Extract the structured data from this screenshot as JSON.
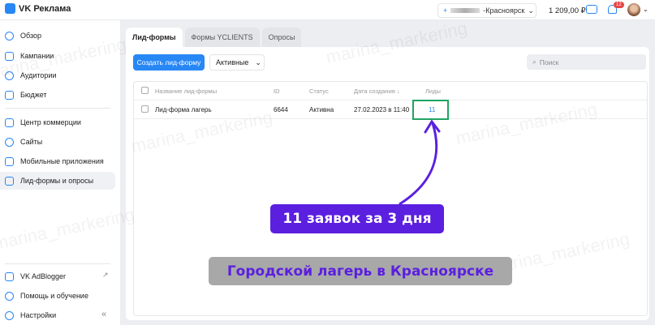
{
  "app": {
    "title": "VK Реклама"
  },
  "topbar": {
    "account": "-Красноярск",
    "balance": "1 209,00 ₽",
    "notifications": "12"
  },
  "sidebar": {
    "items": [
      {
        "label": "Обзор",
        "icon": "compass-icon"
      },
      {
        "label": "Кампании",
        "icon": "megaphone-icon"
      },
      {
        "label": "Аудитории",
        "icon": "audience-icon"
      },
      {
        "label": "Бюджет",
        "icon": "wallet-icon"
      },
      {
        "label": "Центр коммерции",
        "icon": "cart-icon"
      },
      {
        "label": "Сайты",
        "icon": "globe-icon"
      },
      {
        "label": "Мобильные приложения",
        "icon": "phone-icon"
      },
      {
        "label": "Лид-формы и опросы",
        "icon": "form-icon"
      }
    ],
    "bottom": [
      {
        "label": "VK AdBlogger",
        "icon": "adblogger-icon"
      },
      {
        "label": "Помощь и обучение",
        "icon": "help-icon"
      },
      {
        "label": "Настройки",
        "icon": "gear-icon"
      }
    ]
  },
  "tabs": [
    {
      "label": "Лид-формы"
    },
    {
      "label": "Формы YCLIENTS"
    },
    {
      "label": "Опросы"
    }
  ],
  "toolbar": {
    "create": "Создать лид-форму",
    "filter": "Активные",
    "search_placeholder": "Поиск"
  },
  "table": {
    "headers": [
      "Название лид-формы",
      "ID",
      "Статус",
      "Дата создания ↓",
      "Лиды"
    ],
    "rows": [
      [
        "Лид-форма лагерь",
        "6644",
        "Активна",
        "27.02.2023 в 11:40",
        "11"
      ]
    ]
  },
  "annotations": {
    "callout": "11 заявок за 3 дня",
    "caption": "Городской лагерь в Красноярске",
    "callout_color": "#5b1fe0",
    "highlight_color": "#1fa463"
  },
  "watermark": "marina_markering"
}
